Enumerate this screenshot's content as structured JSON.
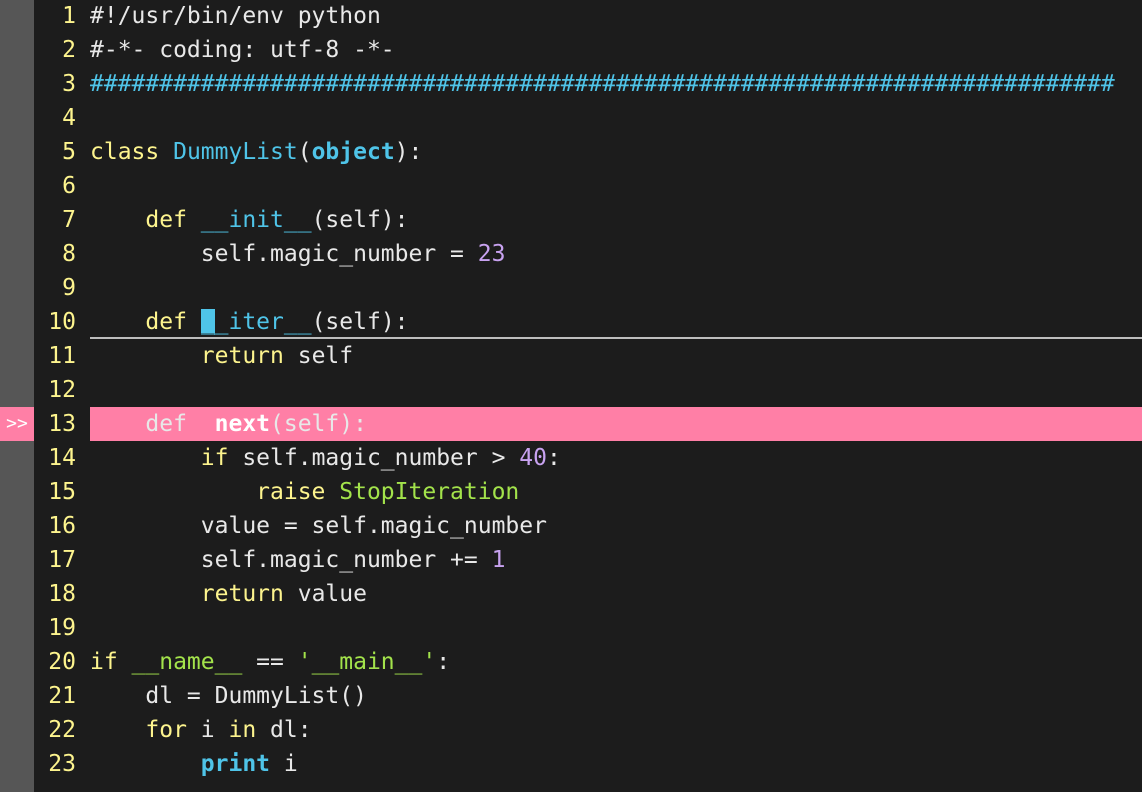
{
  "editor": {
    "colors": {
      "background": "#1c1c1c",
      "sign_column": "#565656",
      "breakpoint_line": "#ff7fa6",
      "line_numbers": "#fdf48e",
      "cursor": "#4fc4e8"
    },
    "breakpoint_sign": ">>",
    "breakpoint_line": 13,
    "cursor_line": 10,
    "lines": [
      {
        "num": "1",
        "tokens": [
          {
            "t": "#!/usr/bin/env python",
            "k": "comment"
          }
        ]
      },
      {
        "num": "2",
        "tokens": [
          {
            "t": "#-*- coding: utf-8 -*-",
            "k": "comment"
          }
        ]
      },
      {
        "num": "3",
        "tokens": [
          {
            "t": "##########################################################################",
            "k": "hash"
          }
        ]
      },
      {
        "num": "4",
        "tokens": []
      },
      {
        "num": "5",
        "tokens": [
          {
            "t": "class ",
            "k": "keyword"
          },
          {
            "t": "DummyList",
            "k": "classname"
          },
          {
            "t": "(",
            "k": "plain"
          },
          {
            "t": "object",
            "k": "builtin"
          },
          {
            "t": "):",
            "k": "plain"
          }
        ]
      },
      {
        "num": "6",
        "tokens": []
      },
      {
        "num": "7",
        "tokens": [
          {
            "t": "    def ",
            "k": "keyword"
          },
          {
            "t": "__init__",
            "k": "dunder"
          },
          {
            "t": "(self):",
            "k": "plain"
          }
        ]
      },
      {
        "num": "8",
        "tokens": [
          {
            "t": "        self.magic_number = ",
            "k": "plain"
          },
          {
            "t": "23",
            "k": "number"
          }
        ]
      },
      {
        "num": "9",
        "tokens": []
      },
      {
        "num": "10",
        "tokens": [
          {
            "t": "    def ",
            "k": "keyword"
          },
          {
            "t": "_",
            "k": "cursor"
          },
          {
            "t": "_iter__",
            "k": "dunder"
          },
          {
            "t": "(self):",
            "k": "plain"
          }
        ]
      },
      {
        "num": "11",
        "tokens": [
          {
            "t": "        return ",
            "k": "keyword"
          },
          {
            "t": "self",
            "k": "plain"
          }
        ]
      },
      {
        "num": "12",
        "tokens": []
      },
      {
        "num": "13",
        "tokens": [
          {
            "t": "    def  ",
            "k": "plain"
          },
          {
            "t": "next",
            "k": "func-bold"
          },
          {
            "t": "(self):",
            "k": "plain"
          }
        ]
      },
      {
        "num": "14",
        "tokens": [
          {
            "t": "        if ",
            "k": "keyword"
          },
          {
            "t": "self.magic_number > ",
            "k": "plain"
          },
          {
            "t": "40",
            "k": "number"
          },
          {
            "t": ":",
            "k": "plain"
          }
        ]
      },
      {
        "num": "15",
        "tokens": [
          {
            "t": "            raise ",
            "k": "keyword"
          },
          {
            "t": "StopIteration",
            "k": "exc"
          }
        ]
      },
      {
        "num": "16",
        "tokens": [
          {
            "t": "        value = self.magic_number",
            "k": "plain"
          }
        ]
      },
      {
        "num": "17",
        "tokens": [
          {
            "t": "        self.magic_number += ",
            "k": "plain"
          },
          {
            "t": "1",
            "k": "number"
          }
        ]
      },
      {
        "num": "18",
        "tokens": [
          {
            "t": "        return ",
            "k": "keyword"
          },
          {
            "t": "value",
            "k": "plain"
          }
        ]
      },
      {
        "num": "19",
        "tokens": []
      },
      {
        "num": "20",
        "tokens": [
          {
            "t": "if ",
            "k": "keyword"
          },
          {
            "t": "__name__",
            "k": "string"
          },
          {
            "t": " == ",
            "k": "plain"
          },
          {
            "t": "'__main__'",
            "k": "string"
          },
          {
            "t": ":",
            "k": "plain"
          }
        ]
      },
      {
        "num": "21",
        "tokens": [
          {
            "t": "    dl = DummyList()",
            "k": "plain"
          }
        ]
      },
      {
        "num": "22",
        "tokens": [
          {
            "t": "    for ",
            "k": "keyword"
          },
          {
            "t": "i ",
            "k": "plain"
          },
          {
            "t": "in ",
            "k": "keyword"
          },
          {
            "t": "dl:",
            "k": "plain"
          }
        ]
      },
      {
        "num": "23",
        "tokens": [
          {
            "t": "        print ",
            "k": "builtin"
          },
          {
            "t": "i",
            "k": "plain"
          }
        ]
      }
    ]
  }
}
